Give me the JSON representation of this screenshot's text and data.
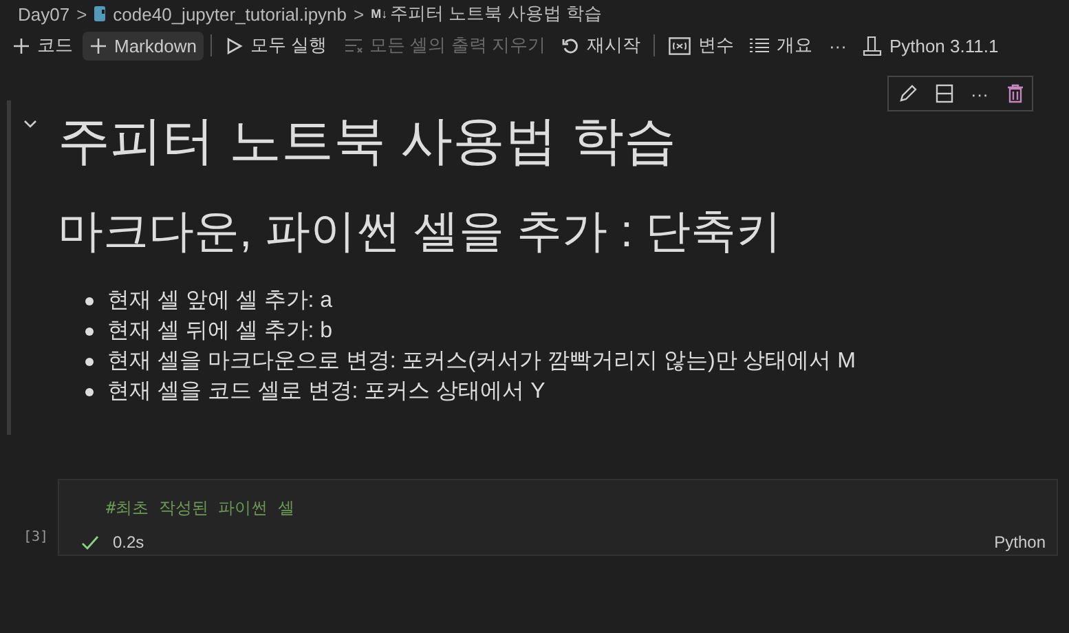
{
  "breadcrumb": {
    "folder": "Day07",
    "separator": ">",
    "file": "code40_jupyter_tutorial.ipynb",
    "section_marker": "M↓",
    "section": "주피터 노트북 사용법 학습"
  },
  "toolbar": {
    "items": [
      {
        "kind": "plus",
        "label": "코드",
        "disabled": false,
        "hovered": false
      },
      {
        "kind": "plus",
        "label": "Markdown",
        "disabled": false,
        "hovered": true
      },
      {
        "kind": "divider"
      },
      {
        "kind": "run",
        "label": "모두 실행",
        "disabled": false,
        "hovered": false
      },
      {
        "kind": "clear",
        "label": "모든 셀의 출력 지우기",
        "disabled": true,
        "hovered": false
      },
      {
        "kind": "restart",
        "label": "재시작",
        "disabled": false,
        "hovered": false
      },
      {
        "kind": "divider"
      },
      {
        "kind": "variables",
        "label": "변수",
        "disabled": false,
        "hovered": false
      },
      {
        "kind": "outline",
        "label": "개요",
        "disabled": false,
        "hovered": false
      },
      {
        "kind": "more",
        "label": "···",
        "disabled": false,
        "hovered": false
      },
      {
        "kind": "kernel",
        "label": "Python 3.11.1",
        "disabled": false,
        "hovered": false
      }
    ]
  },
  "markdown_cell": {
    "expanded": true,
    "heading1": "주피터 노트북 사용법 학습",
    "heading2": "마크다운, 파이썬 셀을 추가 : 단축키",
    "bullets": [
      "현재 셀 앞에 셀 추가: a",
      "현재 셀 뒤에 셀 추가: b",
      "현재 셀을 마크다운으로 변경: 포커스(커서가 깜빡거리지 않는)만 상태에서 M",
      "현재 셀을 코드 셀로 변경: 포커스 상태에서 Y"
    ],
    "cell_toolbar": {
      "more": "···"
    }
  },
  "code_cell": {
    "execution_count": "[3]",
    "code": "#최초 작성된 파이썬 셀",
    "succeeded": true,
    "duration": "0.2s",
    "language": "Python"
  }
}
